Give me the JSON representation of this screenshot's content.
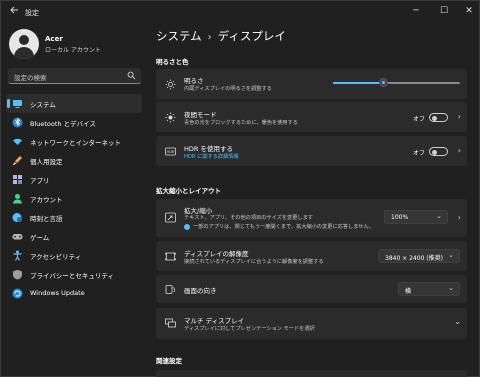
{
  "window": {
    "title": "設定",
    "back_icon": "back-arrow-icon",
    "min_glyph": "─",
    "max_glyph": "☐",
    "close_glyph": "✕"
  },
  "user": {
    "name": "Acer",
    "account_type": "ローカル アカウント"
  },
  "search": {
    "placeholder": "設定の検索"
  },
  "sidebar": {
    "items": [
      {
        "label": "システム",
        "icon": "system-icon",
        "color": "#4cc2ff",
        "active": true
      },
      {
        "label": "Bluetooth とデバイス",
        "icon": "bluetooth-icon",
        "color": "#4cc2ff"
      },
      {
        "label": "ネットワークとインターネット",
        "icon": "wifi-icon",
        "color": "#4cc2ff"
      },
      {
        "label": "個人用設定",
        "icon": "brush-icon",
        "color": "#f7a15b"
      },
      {
        "label": "アプリ",
        "icon": "apps-icon",
        "color": "#b5b5d8"
      },
      {
        "label": "アカウント",
        "icon": "person-icon",
        "color": "#47d18b"
      },
      {
        "label": "時刻と言語",
        "icon": "globe-clock-icon",
        "color": "#4cc2ff"
      },
      {
        "label": "ゲーム",
        "icon": "gamepad-icon",
        "color": "#b5b5b5"
      },
      {
        "label": "アクセシビリティ",
        "icon": "accessibility-icon",
        "color": "#6fb8f0"
      },
      {
        "label": "プライバシーとセキュリティ",
        "icon": "shield-icon",
        "color": "#9e9e9e"
      },
      {
        "label": "Windows Update",
        "icon": "update-icon",
        "color": "#4cc2ff"
      }
    ]
  },
  "breadcrumb": {
    "parent": "システム",
    "separator": "›",
    "current": "ディスプレイ"
  },
  "sections": {
    "brightness_color": "明るさと色",
    "scale_layout": "拡大縮小とレイアウト",
    "related": "関連設定"
  },
  "brightness": {
    "title": "明るさ",
    "subtitle": "内蔵ディスプレイの明るさを調整する",
    "level_percent": 40
  },
  "night_light": {
    "title": "夜間モード",
    "subtitle": "青色の光をブロックするために、暖色を使用する",
    "state": "オフ"
  },
  "hdr": {
    "title": "HDR を使用する",
    "link": "HDR に関する詳細情報",
    "state": "オフ"
  },
  "scale": {
    "title": "拡大/縮小",
    "subtitle": "テキスト、アプリ、その他の項目のサイズを変更します",
    "note": "一部のアプリは、閉じてもう一度開くまで、拡大縮小の変更に応答しません。",
    "value": "100%"
  },
  "resolution": {
    "title": "ディスプレイの解像度",
    "subtitle": "接続されているディスプレイに合うように解像度を調整する",
    "value": "3840 × 2400 (推奨)"
  },
  "orientation": {
    "title": "画面の向き",
    "value": "横"
  },
  "multi_display": {
    "title": "マルチ ディスプレイ",
    "subtitle": "ディスプレイに対してプレゼンテーション モードを選択"
  },
  "colors": {
    "accent": "#4cc2ff",
    "card": "#2b2b2b",
    "background": "#202020"
  }
}
